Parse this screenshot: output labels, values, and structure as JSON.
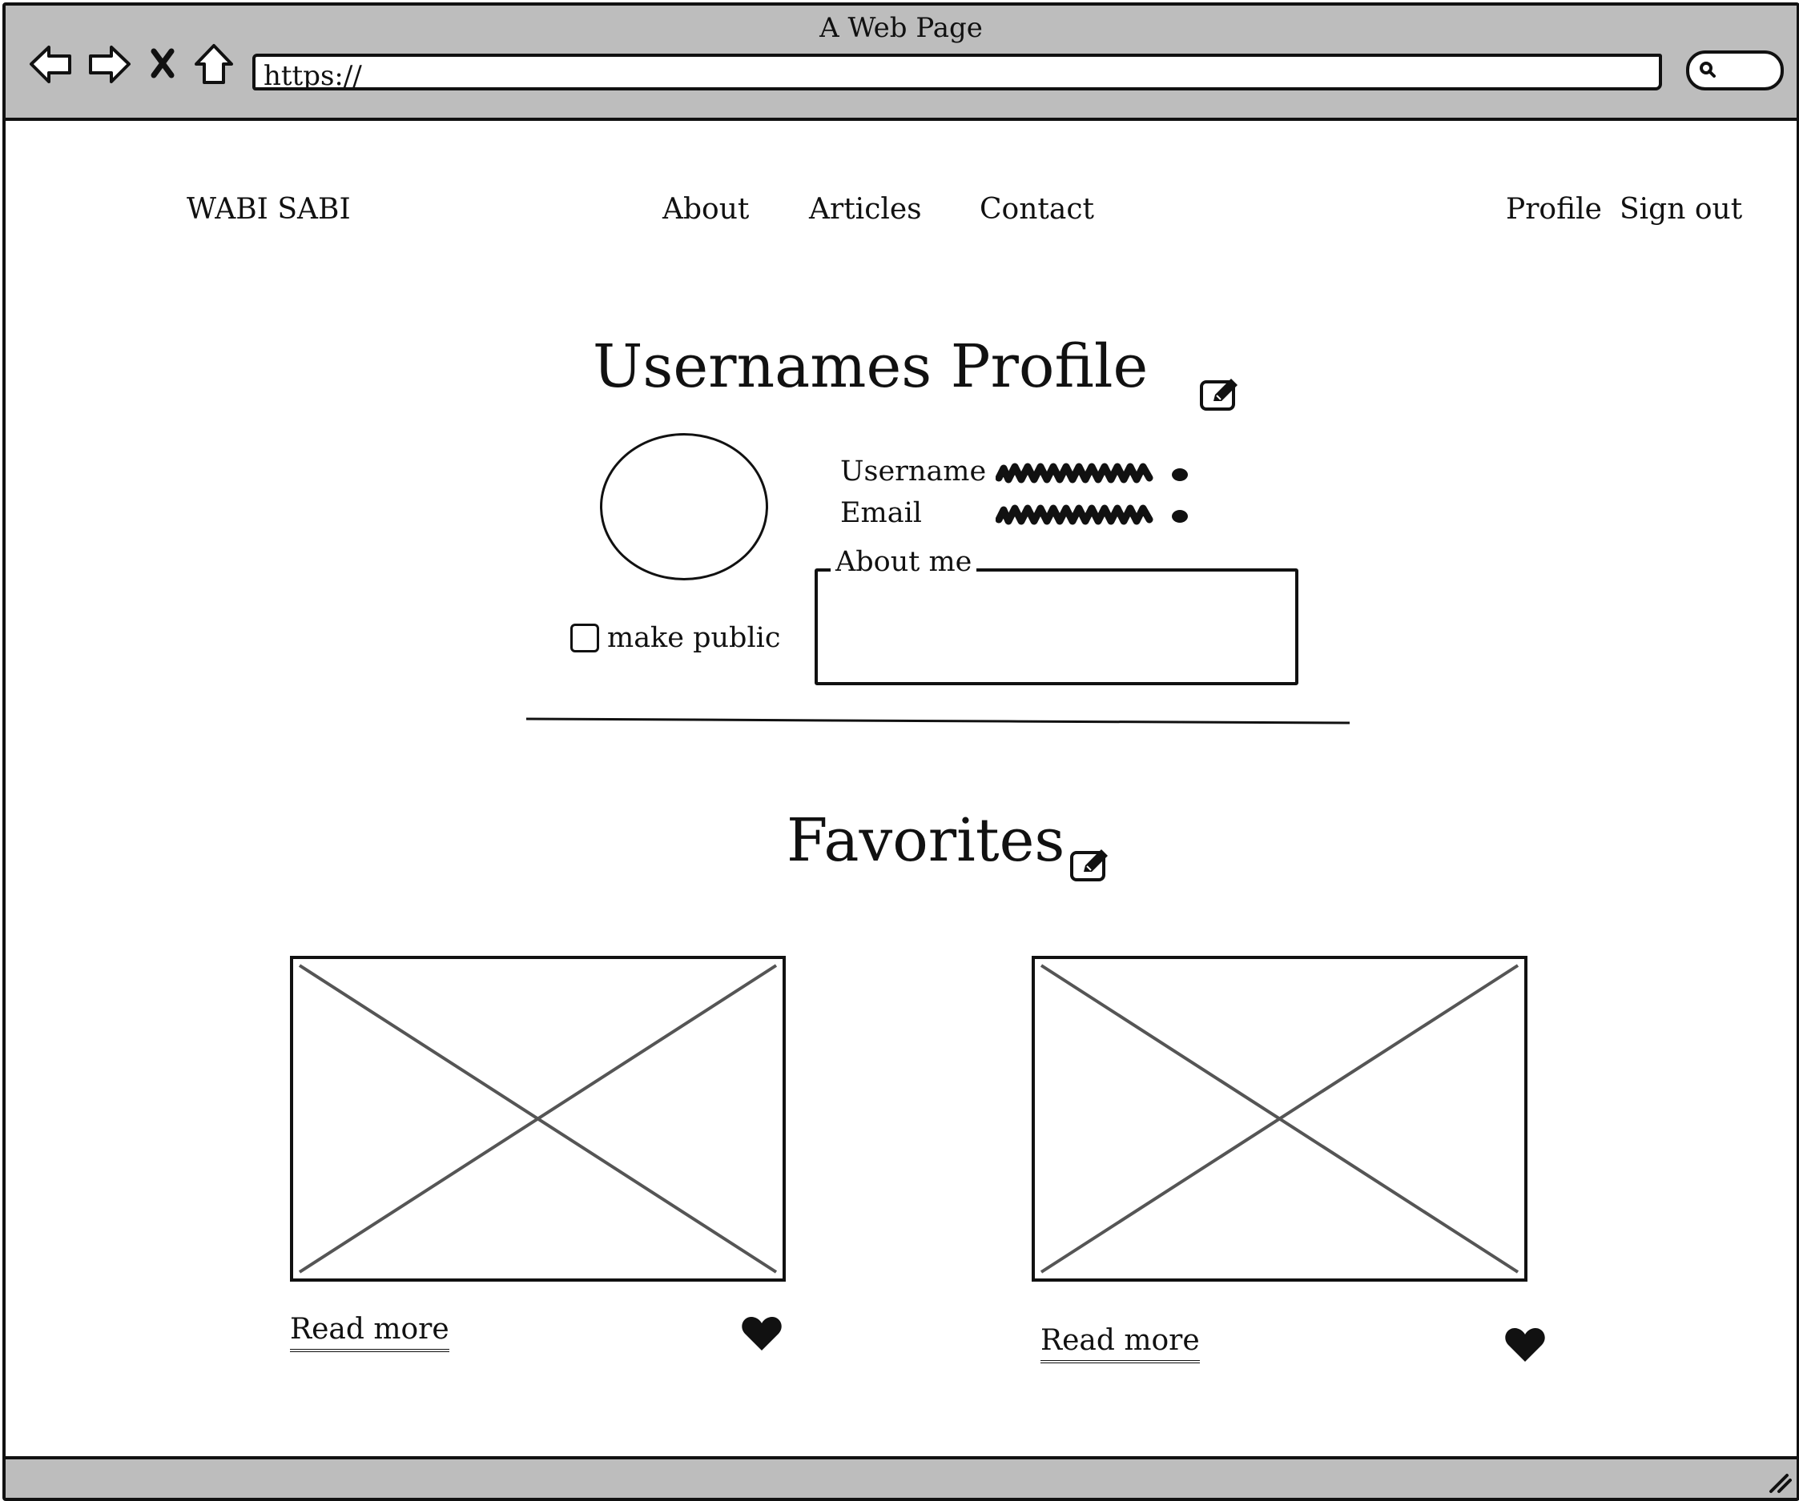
{
  "browser": {
    "window_title": "A Web Page",
    "url": "https://"
  },
  "site": {
    "brand": "WABI SABI",
    "nav_links": [
      "About",
      "Articles",
      "Contact"
    ],
    "account_links": [
      "Profile",
      "Sign out"
    ]
  },
  "profile": {
    "title": "Usernames Profile",
    "fields": [
      {
        "label": "Username"
      },
      {
        "label": "Email"
      }
    ],
    "make_public_label": "make public",
    "make_public_checked": false,
    "about_label": "About me",
    "about_text": ""
  },
  "favorites": {
    "title": "Favorites",
    "items": [
      {
        "link_label": "Read more",
        "liked": true
      },
      {
        "link_label": "Read more",
        "liked": true
      }
    ]
  }
}
